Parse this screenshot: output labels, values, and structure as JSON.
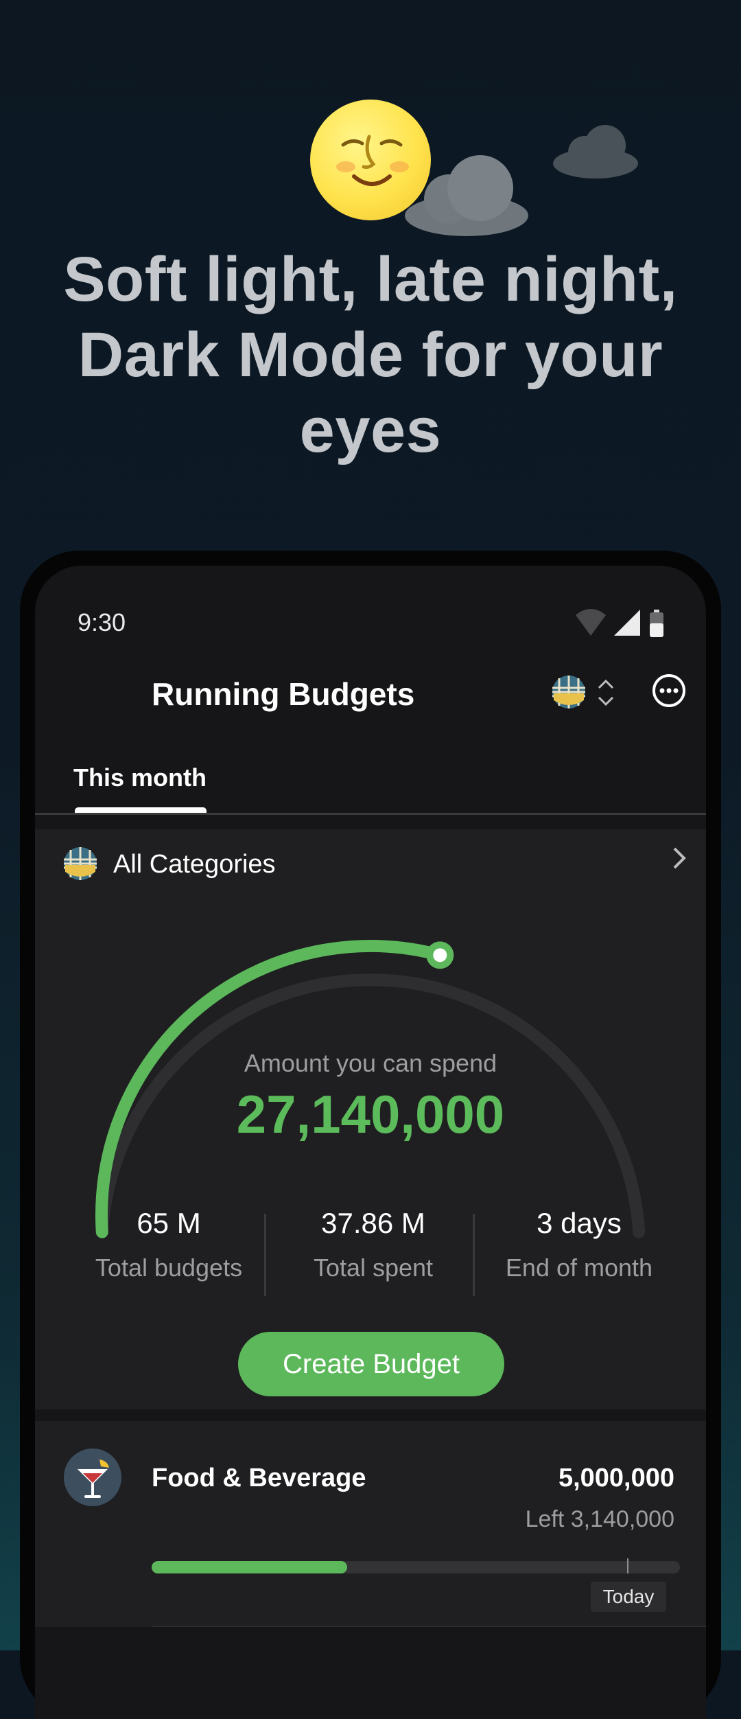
{
  "headline": "Soft light, late night, Dark Mode for your eyes",
  "status_bar": {
    "time": "9:30"
  },
  "header": {
    "title": "Running Budgets"
  },
  "tabs": [
    {
      "label": "This month",
      "active": true
    }
  ],
  "summary": {
    "category_label": "All Categories",
    "caption": "Amount you can spend",
    "amount": "27,140,000",
    "gauge_progress": 0.58,
    "stats": [
      {
        "value": "65 M",
        "label": "Total budgets"
      },
      {
        "value": "37.86 M",
        "label": "Total spent"
      },
      {
        "value": "3 days",
        "label": "End of month"
      }
    ],
    "create_button": "Create Budget"
  },
  "budgets": [
    {
      "name": "Food & Beverage",
      "amount": "5,000,000",
      "left": "Left 3,140,000",
      "progress": 0.37,
      "today_marker": "Today",
      "today_position": 0.9
    }
  ],
  "colors": {
    "accent": "#5cb85b",
    "background": "#161618",
    "card": "#1f1f21"
  },
  "icons": [
    "moon-face-icon",
    "cloud-icon",
    "wifi-icon",
    "signal-icon",
    "battery-icon",
    "globe-wallet-icon",
    "chevron-up-down-icon",
    "more-options-icon",
    "chevron-right-icon",
    "cocktail-icon"
  ]
}
